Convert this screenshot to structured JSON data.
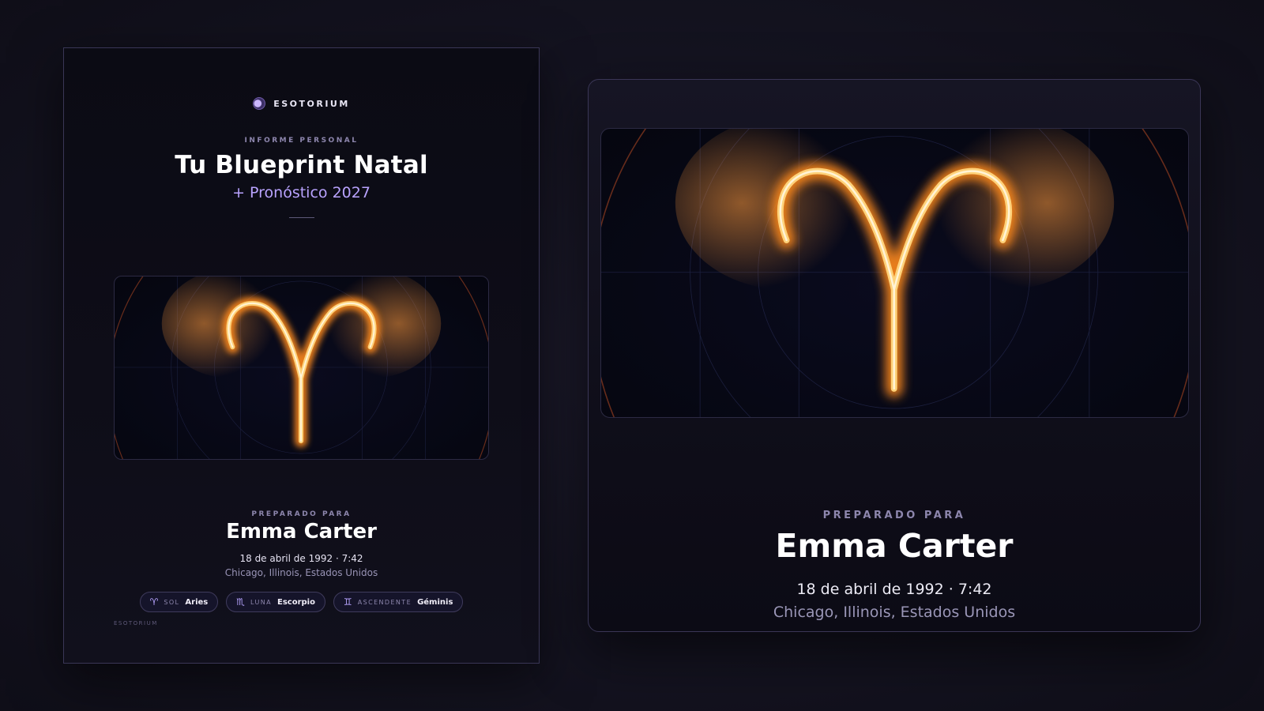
{
  "brand": {
    "name": "ESOTORIUM",
    "footer": "ESOTORIUM"
  },
  "report": {
    "eyebrow": "INFORME PERSONAL",
    "title": "Tu Blueprint Natal",
    "subtitle": "+ Pronóstico 2027"
  },
  "client": {
    "prepared_label": "PREPARADO PARA",
    "name": "Emma Carter",
    "birth_date": "18 de abril de 1992 · 7:42",
    "birth_place": "Chicago, Illinois, Estados Unidos"
  },
  "placements": [
    {
      "glyph": "♈",
      "icon": "aries-icon",
      "label": "SOL",
      "value": "Aries"
    },
    {
      "glyph": "♏",
      "icon": "scorpio-icon",
      "label": "LUNA",
      "value": "Escorpio"
    },
    {
      "glyph": "♊",
      "icon": "gemini-icon",
      "label": "ASCENDENTE",
      "value": "Géminis"
    }
  ],
  "artwork": {
    "subject": "aries-glyph-glow",
    "glow_color": "#ffb347",
    "core_color": "#fff4d6",
    "ring_color": "#8a3a1f"
  },
  "colors": {
    "accent": "#b9a3ff",
    "background": "#141320",
    "panel": "#0b0b14",
    "border": "#3a3656",
    "muted_text": "#8d86ad"
  }
}
